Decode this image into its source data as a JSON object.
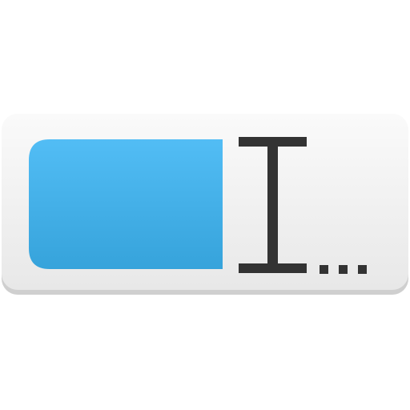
{
  "icon": {
    "name": "text-field-rename-icon",
    "colors": {
      "panel_top": "#fafafa",
      "panel_bottom": "#e8e8e8",
      "panel_shadow": "#d0d0d0",
      "selection_top": "#52bdf5",
      "selection_bottom": "#36a3db",
      "cursor": "#333333"
    }
  }
}
